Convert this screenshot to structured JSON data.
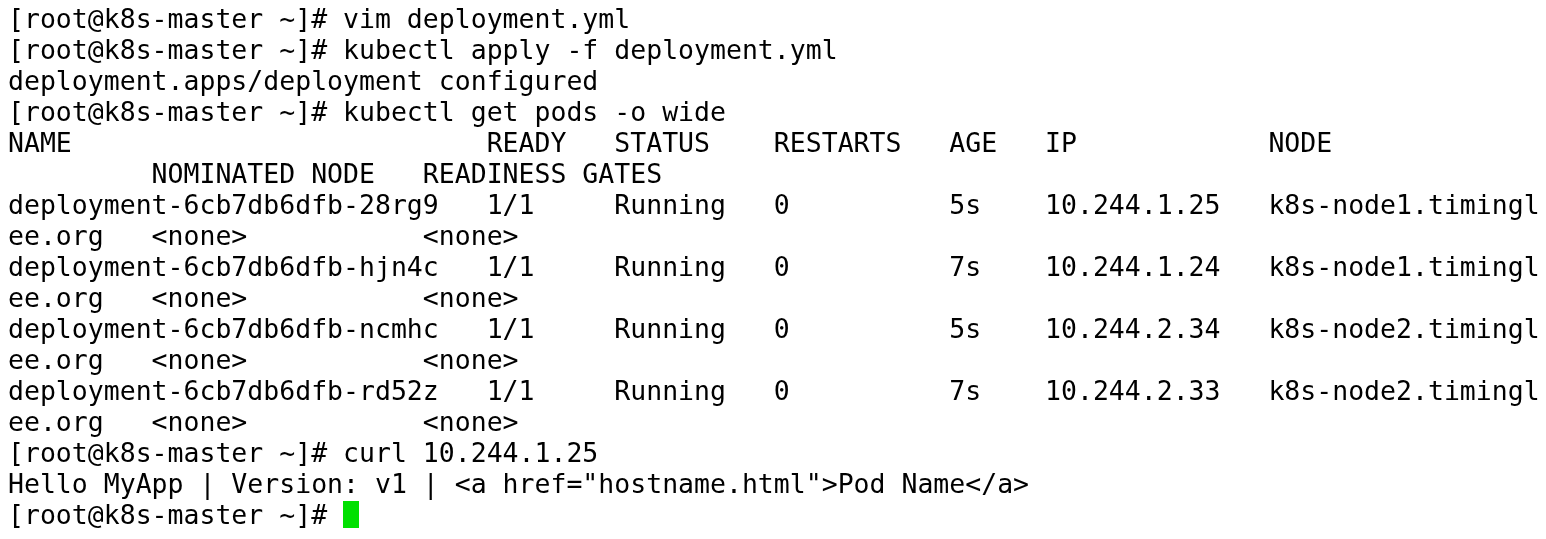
{
  "terminal": {
    "lines": [
      {
        "text": "[root@k8s-master ~]# vim deployment.yml"
      },
      {
        "text": "[root@k8s-master ~]# kubectl apply -f deployment.yml"
      },
      {
        "text": "deployment.apps/deployment configured"
      },
      {
        "text": "[root@k8s-master ~]# kubectl get pods -o wide"
      },
      {
        "text": "NAME                          READY   STATUS    RESTARTS   AGE   IP            NODE"
      },
      {
        "text": "         NOMINATED NODE   READINESS GATES"
      },
      {
        "text": "deployment-6cb7db6dfb-28rg9   1/1     Running   0          5s    10.244.1.25   k8s-node1.timingl"
      },
      {
        "text": "ee.org   <none>           <none>"
      },
      {
        "text": "deployment-6cb7db6dfb-hjn4c   1/1     Running   0          7s    10.244.1.24   k8s-node1.timingl"
      },
      {
        "text": "ee.org   <none>           <none>"
      },
      {
        "text": "deployment-6cb7db6dfb-ncmhc   1/1     Running   0          5s    10.244.2.34   k8s-node2.timingl"
      },
      {
        "text": "ee.org   <none>           <none>"
      },
      {
        "text": "deployment-6cb7db6dfb-rd52z   1/1     Running   0          7s    10.244.2.33   k8s-node2.timingl"
      },
      {
        "text": "ee.org   <none>           <none>"
      },
      {
        "text": "[root@k8s-master ~]# curl 10.244.1.25"
      },
      {
        "text": "Hello MyApp | Version: v1 | <a href=\"hostname.html\">Pod Name</a>"
      },
      {
        "text": "[root@k8s-master ~]# "
      }
    ],
    "cursor_visible": true
  }
}
